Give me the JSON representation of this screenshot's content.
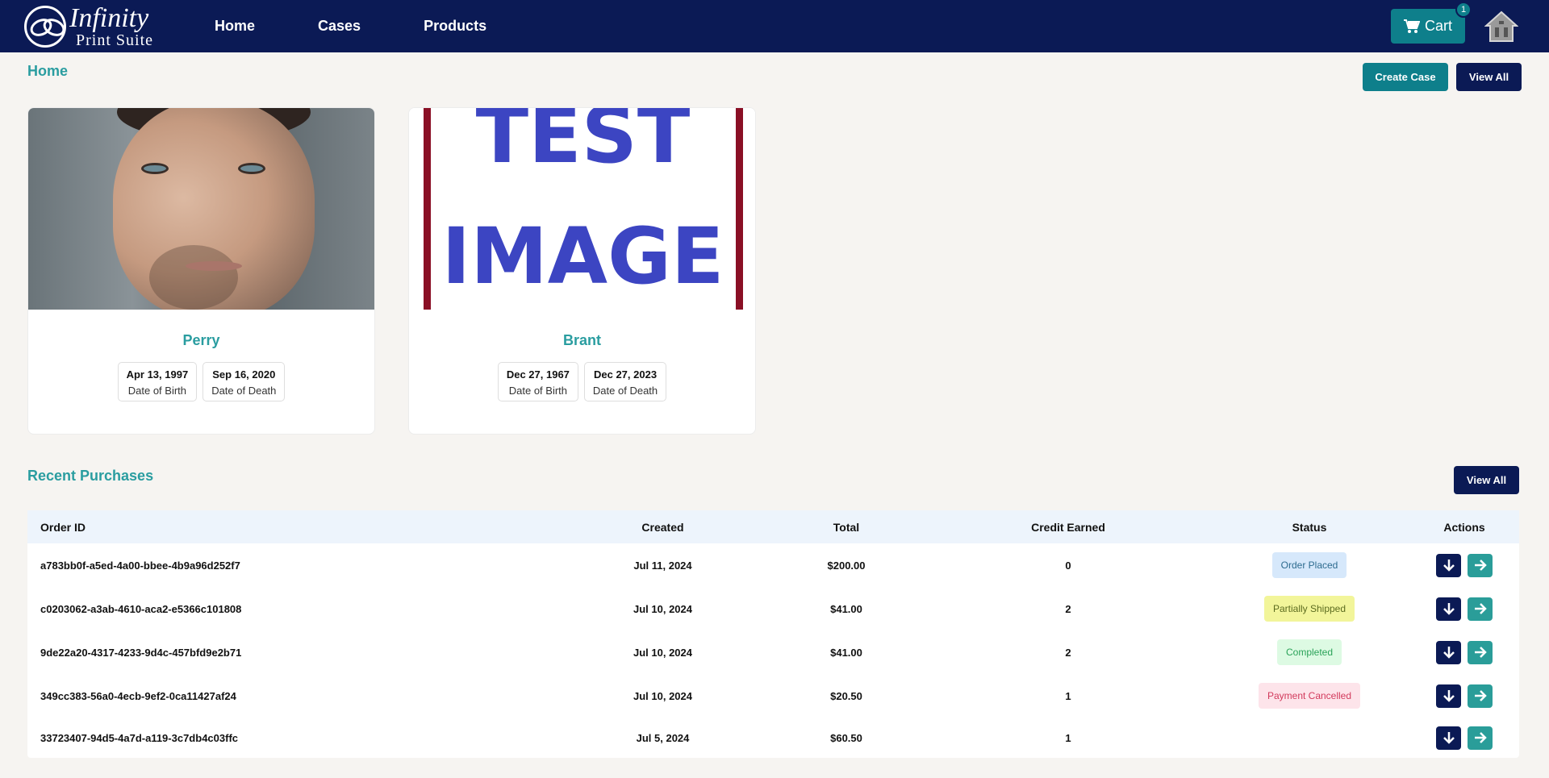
{
  "nav": {
    "logo_line1": "Infinity",
    "logo_line2": "Print Suite",
    "links": [
      "Home",
      "Cases",
      "Products"
    ],
    "cart_label": "Cart",
    "cart_count": "1"
  },
  "page": {
    "title": "Home",
    "create_case_label": "Create Case",
    "view_all_label": "View All"
  },
  "cases": [
    {
      "name": "Perry",
      "image": "portrait-photo",
      "birth": "Apr 13, 1997",
      "birth_label": "Date of Birth",
      "death": "Sep 16, 2020",
      "death_label": "Date of Death"
    },
    {
      "name": "Brant",
      "image": "test-image",
      "image_text": [
        "TEST",
        "IMAGE"
      ],
      "birth": "Dec 27, 1967",
      "birth_label": "Date of Birth",
      "death": "Dec 27, 2023",
      "death_label": "Date of Death"
    }
  ],
  "purchases": {
    "title": "Recent Purchases",
    "view_all_label": "View All",
    "columns": [
      "Order ID",
      "Created",
      "Total",
      "Credit Earned",
      "Status",
      "Actions"
    ],
    "rows": [
      {
        "id": "a783bb0f-a5ed-4a00-bbee-4b9a96d252f7",
        "created": "Jul 11, 2024",
        "total": "$200.00",
        "credit": "0",
        "status": "Order Placed"
      },
      {
        "id": "c0203062-a3ab-4610-aca2-e5366c101808",
        "created": "Jul 10, 2024",
        "total": "$41.00",
        "credit": "2",
        "status": "Partially Shipped"
      },
      {
        "id": "9de22a20-4317-4233-9d4c-457bfd9e2b71",
        "created": "Jul 10, 2024",
        "total": "$41.00",
        "credit": "2",
        "status": "Completed"
      },
      {
        "id": "349cc383-56a0-4ecb-9ef2-0ca11427af24",
        "created": "Jul 10, 2024",
        "total": "$20.50",
        "credit": "1",
        "status": "Payment Cancelled"
      },
      {
        "id": "33723407-94d5-4a7d-a119-3c7db4c03ffc",
        "created": "Jul 5, 2024",
        "total": "$60.50",
        "credit": "1",
        "status": ""
      }
    ],
    "status_colors": {
      "Order Placed": {
        "bg": "#d6e8fb",
        "fg": "#2d6b8f"
      },
      "Partially Shipped": {
        "bg": "#f2f59a",
        "fg": "#5b6b1f"
      },
      "Completed": {
        "bg": "#ddfae3",
        "fg": "#2ba359"
      },
      "Payment Cancelled": {
        "bg": "#fde4ea",
        "fg": "#d23a5c"
      }
    }
  },
  "colors": {
    "navbar": "#0b1a55",
    "teal": "#0e7f8b",
    "heading_teal": "#2a9da0"
  }
}
